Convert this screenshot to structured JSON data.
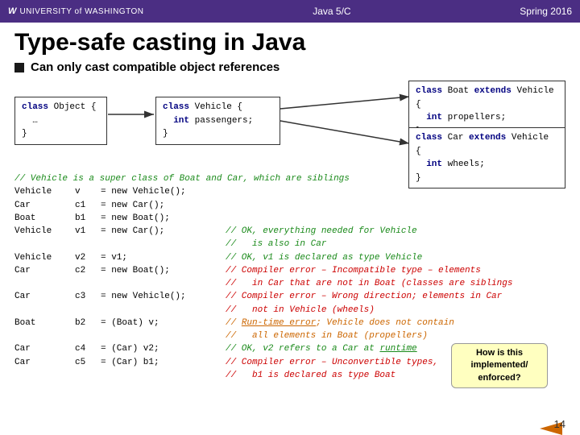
{
  "header": {
    "university": "UNIVERSITY of WASHINGTON",
    "course": "Java 5/C",
    "semester": "Spring 2016"
  },
  "page": {
    "title": "Type-safe casting in Java",
    "bullet": "Can only cast compatible object references"
  },
  "diagram": {
    "box_object": "class Object {\n  …\n}",
    "box_vehicle": "class Vehicle {\n  int passengers;\n}",
    "box_boat": "class Boat extends Vehicle {\n  int propellers;\n}",
    "box_car": "class Car extends Vehicle {\n  int wheels;\n}"
  },
  "code": {
    "comment1": "// Vehicle is a super class of Boat and Car, which are siblings",
    "lines": [
      {
        "col1": "Vehicle",
        "col2": "v",
        "col3": "= new Vehicle();",
        "comment": ""
      },
      {
        "col1": "Car",
        "col2": "c1",
        "col3": "= new Car();",
        "comment": ""
      },
      {
        "col1": "Boat",
        "col2": "b1",
        "col3": "= new Boat();",
        "comment": ""
      },
      {
        "col1": "Vehicle",
        "col2": "v1",
        "col3": "= new Car();",
        "comment": "// OK, everything needed for Vehicle"
      },
      {
        "col1": "",
        "col2": "",
        "col3": "",
        "comment": "//   is also in Car"
      },
      {
        "col1": "Vehicle",
        "col2": "v2",
        "col3": "= v1;",
        "comment": "// OK, v1 is declared as type Vehicle"
      },
      {
        "col1": "Car",
        "col2": "c2",
        "col3": "= new Boat();",
        "comment": "// Compiler error – Incompatible type – elements"
      },
      {
        "col1": "",
        "col2": "",
        "col3": "",
        "comment": "//   in Car that are not in Boat (classes are siblings"
      },
      {
        "col1": "Car",
        "col2": "c3",
        "col3": "= new Vehicle();",
        "comment": "// Compiler error – Wrong direction; elements in Car"
      },
      {
        "col1": "",
        "col2": "",
        "col3": "",
        "comment": "//   not in Vehicle (wheels)"
      },
      {
        "col1": "Boat",
        "col2": "b2",
        "col3": "= (Boat) v;",
        "comment": "// Run-time error; Vehicle does not contain"
      },
      {
        "col1": "",
        "col2": "",
        "col3": "",
        "comment": "//   all elements in Boat (propellers)"
      },
      {
        "col1": "Car",
        "col2": "c4",
        "col3": "= (Car) v2;",
        "comment": "// OK, v2 refers to a Car at runtime"
      },
      {
        "col1": "Car",
        "col2": "c5",
        "col3": "= (Car) b1;",
        "comment": "// Compiler error – Unconvertible types,"
      },
      {
        "col1": "",
        "col2": "",
        "col3": "",
        "comment": "//   b1 is declared as type Boat"
      }
    ]
  },
  "callout": {
    "text": "How is this\nimplemented/\nenforced?"
  },
  "slide_number": "14"
}
